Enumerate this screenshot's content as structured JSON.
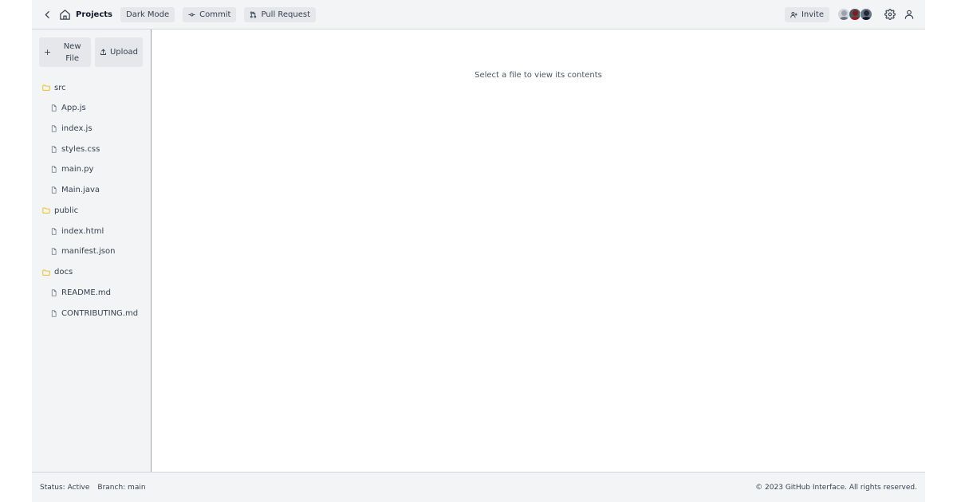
{
  "header": {
    "title": "Projects",
    "dark_mode_label": "Dark Mode",
    "commit_label": "Commit",
    "pull_request_label": "Pull Request",
    "invite_label": "Invite",
    "avatars": [
      {
        "face": "#9ca3af",
        "body": "#6b7280",
        "bg": "#d1d5db"
      },
      {
        "face": "#7f1d1d",
        "body": "#991b1b",
        "bg": "#4b5563"
      },
      {
        "face": "#1f2937",
        "body": "#111827",
        "bg": "#6b7280"
      }
    ]
  },
  "sidebar": {
    "new_file_label": "New File",
    "upload_label": "Upload",
    "tree": [
      {
        "folder": "src",
        "files": [
          "App.js",
          "index.js",
          "styles.css",
          "main.py",
          "Main.java"
        ]
      },
      {
        "folder": "public",
        "files": [
          "index.html",
          "manifest.json"
        ]
      },
      {
        "folder": "docs",
        "files": [
          "README.md",
          "CONTRIBUTING.md"
        ]
      }
    ]
  },
  "content": {
    "placeholder": "Select a file to view its contents"
  },
  "footer": {
    "status": "Status: Active",
    "branch": "Branch: main",
    "copyright": "© 2023 GitHub Interface. All rights reserved."
  },
  "colors": {
    "folder_icon": "#eab308",
    "header_bg": "#f3f4f6",
    "chip_bg": "#e5e7eb"
  }
}
